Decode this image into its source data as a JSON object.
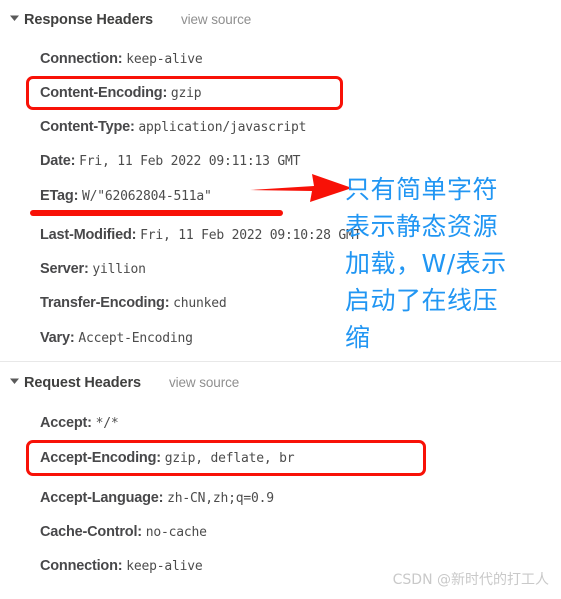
{
  "sections": [
    {
      "id": "response-headers",
      "title": "Response Headers",
      "view_source_label": "view source",
      "twisty": "triangle-down-icon",
      "rows": [
        {
          "name": "Connection:",
          "value": "keep-alive"
        },
        {
          "name": "Content-Encoding:",
          "value": "gzip"
        },
        {
          "name": "Content-Type:",
          "value": "application/javascript"
        },
        {
          "name": "Date:",
          "value": "Fri, 11 Feb 2022 09:11:13 GMT"
        },
        {
          "name": "ETag:",
          "value": "W/\"62062804-511a\""
        },
        {
          "name": "Last-Modified:",
          "value": "Fri, 11 Feb 2022 09:10:28 GMT"
        },
        {
          "name": "Server:",
          "value": "yillion"
        },
        {
          "name": "Transfer-Encoding:",
          "value": "chunked"
        },
        {
          "name": "Vary:",
          "value": "Accept-Encoding"
        }
      ]
    },
    {
      "id": "request-headers",
      "title": "Request Headers",
      "view_source_label": "view source",
      "twisty": "triangle-down-icon",
      "rows": [
        {
          "name": "Accept:",
          "value": "*/*"
        },
        {
          "name": "Accept-Encoding:",
          "value": "gzip, deflate, br"
        },
        {
          "name": "Accept-Language:",
          "value": "zh-CN,zh;q=0.9"
        },
        {
          "name": "Cache-Control:",
          "value": "no-cache"
        },
        {
          "name": "Connection:",
          "value": "keep-alive"
        }
      ]
    }
  ],
  "annotation": {
    "text": "只有简单字符\n表示静态资源\n加载，W/表示\n启动了在线压\n缩",
    "color": "#2196f3"
  },
  "highlights": {
    "color": "#f81107",
    "boxed_rows": [
      "Content-Encoding:",
      "Accept-Encoding:"
    ],
    "underlined_rows": [
      "ETag:"
    ],
    "arrow": "right-arrow-icon"
  },
  "watermark": {
    "text": "CSDN @新时代的打工人"
  }
}
